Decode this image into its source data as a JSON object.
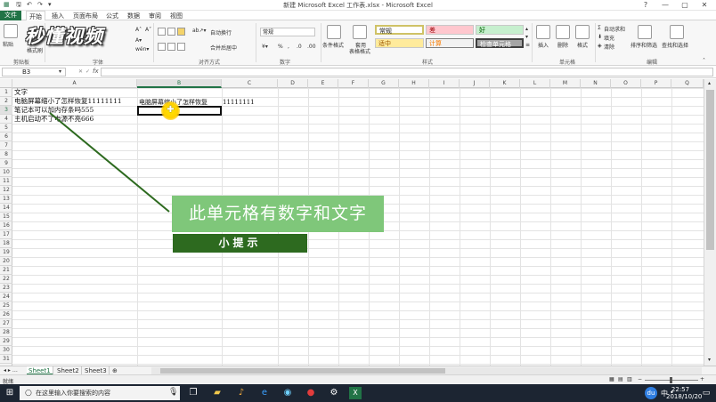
{
  "window": {
    "title": "新建 Microsoft Excel 工作表.xlsx - Microsoft Excel",
    "min": "—",
    "max": "▢",
    "close": "✕",
    "help": "?"
  },
  "tabs": [
    "文件",
    "开始",
    "插入",
    "页面布局",
    "公式",
    "数据",
    "审阅",
    "视图"
  ],
  "ribbon": {
    "clipboard": {
      "paste": "粘贴",
      "format_painter": "格式刷",
      "label": "剪贴板"
    },
    "font": {
      "label": "字体"
    },
    "align": {
      "wrap": "自动换行",
      "merge": "合并后居中",
      "label": "对齐方式"
    },
    "number": {
      "format": "常规",
      "label": "数字",
      "percent": "%"
    },
    "styles": {
      "cond_format": "条件格式",
      "table_format_1": "套用",
      "table_format_2": "表格格式",
      "normal": "常规",
      "bad": "差",
      "good": "好",
      "neutral": "适中",
      "calc": "计算",
      "check": "检查单元格",
      "label": "样式"
    },
    "cells": {
      "insert": "插入",
      "delete": "删除",
      "format": "格式",
      "label": "单元格"
    },
    "editing": {
      "autosum": "自动求和",
      "fill": "填充",
      "clear": "清除",
      "sort": "排序和筛选",
      "find": "查找和选择",
      "label": "编辑"
    }
  },
  "logo": "秒懂视频",
  "formula_bar": {
    "name_box": "B3",
    "fx": "fx",
    "value": ""
  },
  "columns": [
    "A",
    "B",
    "C",
    "D",
    "E",
    "F",
    "G",
    "H",
    "I",
    "J",
    "K",
    "L",
    "M",
    "N",
    "O",
    "P",
    "Q"
  ],
  "rows": [
    "1",
    "2",
    "3",
    "4",
    "5",
    "6",
    "7",
    "8",
    "9",
    "10",
    "11",
    "12",
    "13",
    "14",
    "15",
    "16",
    "17",
    "18",
    "19",
    "20",
    "21",
    "22",
    "23",
    "24",
    "25",
    "26",
    "27",
    "28",
    "29",
    "30",
    "31"
  ],
  "cells": {
    "A1": "文字",
    "A2": "电脑屏幕缩小了怎样恢复11111111",
    "A3": "笔记本可以加内存条吗555",
    "A4": "主机启动不了电源不亮666",
    "B2": "电脑屏幕缩小了怎样恢复",
    "C2": "11111111"
  },
  "annotation": {
    "callout": "此单元格有数字和文字",
    "tip": "小提示"
  },
  "sheets": [
    "Sheet1",
    "Sheet2",
    "Sheet3"
  ],
  "status": {
    "ready": "就绪"
  },
  "taskbar": {
    "search_placeholder": "在这里输入你要搜索的内容",
    "time": "22:57",
    "date": "2018/10/20",
    "ime": "中",
    "input_dot": "•",
    "du": "du"
  },
  "colors": {
    "excel_green": "#217346",
    "callout_green": "#7fc77a",
    "tip_green": "#2d6a1f"
  }
}
